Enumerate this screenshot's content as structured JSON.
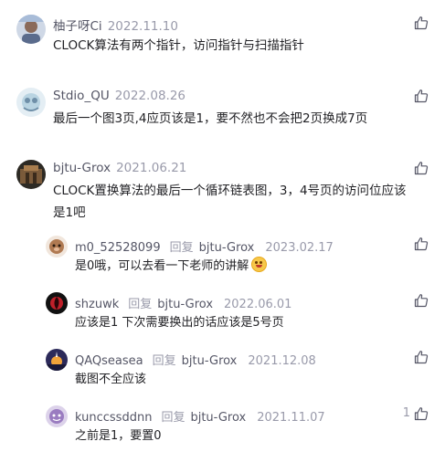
{
  "comments": [
    {
      "user": "柚子呀Ci",
      "date": "2022.11.10",
      "text": "CLOCK算法有两个指针，访问指针与扫描指针"
    },
    {
      "user": "Stdio_QU",
      "date": "2022.08.26",
      "text": "最后一个图3页,4应页该是1，要不然也不会把2页换成7页"
    },
    {
      "user": "bjtu-Grox",
      "date": "2021.06.21",
      "text": "CLOCK置换算法的最后一个循环链表图，3，4号页的访问位应该是1吧"
    }
  ],
  "reply_label": "回复",
  "replies": [
    {
      "user": "m0_52528099",
      "target": "bjtu-Grox",
      "date": "2023.02.17",
      "text": "是0哦，可以去看一下老师的讲解"
    },
    {
      "user": "shzuwk",
      "target": "bjtu-Grox",
      "date": "2022.06.01",
      "text": "应该是1 下次需要换出的话应该是5号页"
    },
    {
      "user": "QAQseasea",
      "target": "bjtu-Grox",
      "date": "2021.12.08",
      "text": "截图不全应该"
    },
    {
      "user": "kunccssddnn",
      "target": "bjtu-Grox",
      "date": "2021.11.07",
      "text": "之前是1，要置0",
      "likes": "1"
    }
  ]
}
